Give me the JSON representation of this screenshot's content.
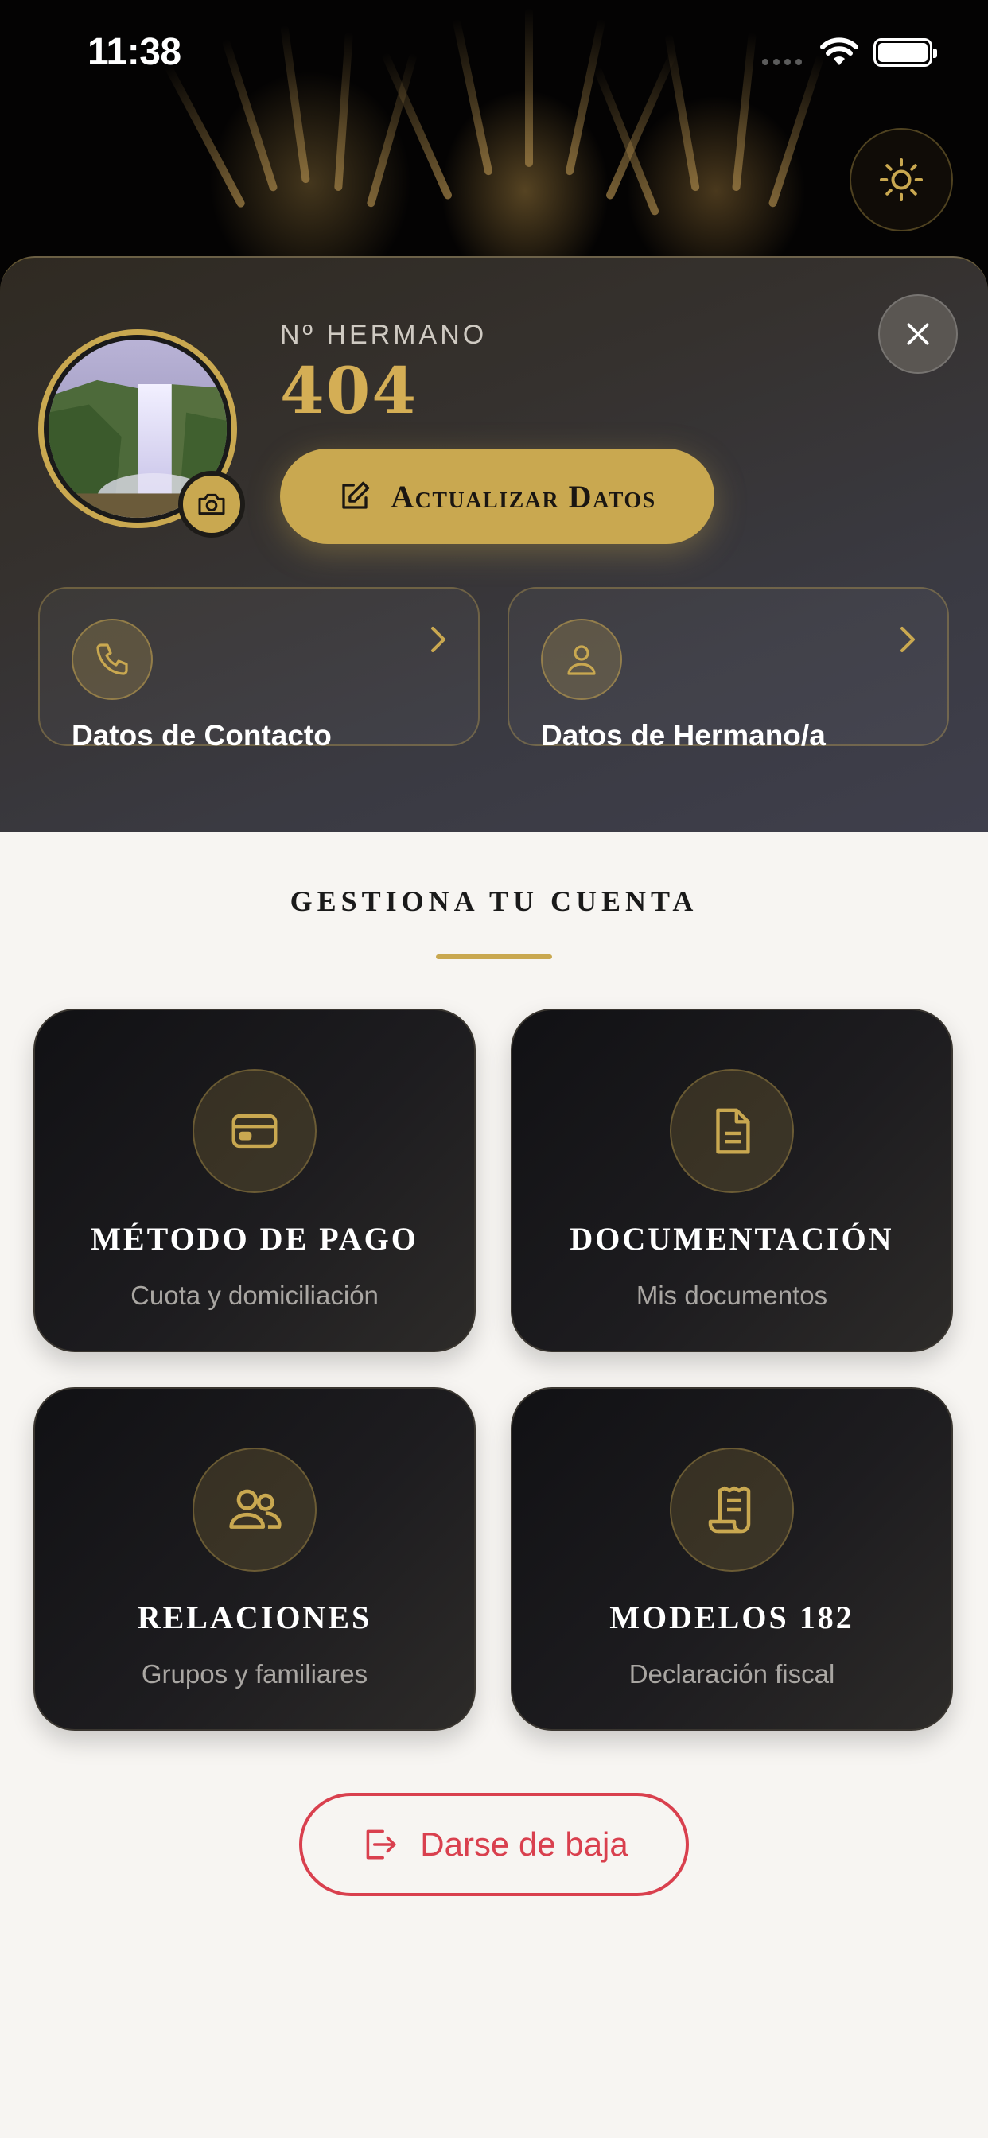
{
  "status_bar": {
    "time": "11:38"
  },
  "profile": {
    "member_label": "Nº HERMANO",
    "member_number": "404",
    "update_button": "Actualizar Datos",
    "cards": [
      {
        "label": "Datos de Contacto",
        "icon": "phone-icon"
      },
      {
        "label": "Datos de Hermano/a",
        "icon": "user-icon"
      }
    ]
  },
  "manage": {
    "title": "GESTIONA TU CUENTA",
    "tiles": [
      {
        "title": "MÉTODO DE PAGO",
        "subtitle": "Cuota y domiciliación",
        "icon": "credit-card-icon"
      },
      {
        "title": "DOCUMENTACIÓN",
        "subtitle": "Mis documentos",
        "icon": "document-icon"
      },
      {
        "title": "RELACIONES",
        "subtitle": "Grupos y familiares",
        "icon": "users-icon"
      },
      {
        "title": "MODELOS 182",
        "subtitle": "Declaración fiscal",
        "icon": "receipt-icon"
      }
    ],
    "unsubscribe": "Darse de baja"
  },
  "colors": {
    "accent": "#c9a850",
    "danger": "#d9404e",
    "background": "#f7f5f2",
    "tile": "#1a1a1d"
  }
}
